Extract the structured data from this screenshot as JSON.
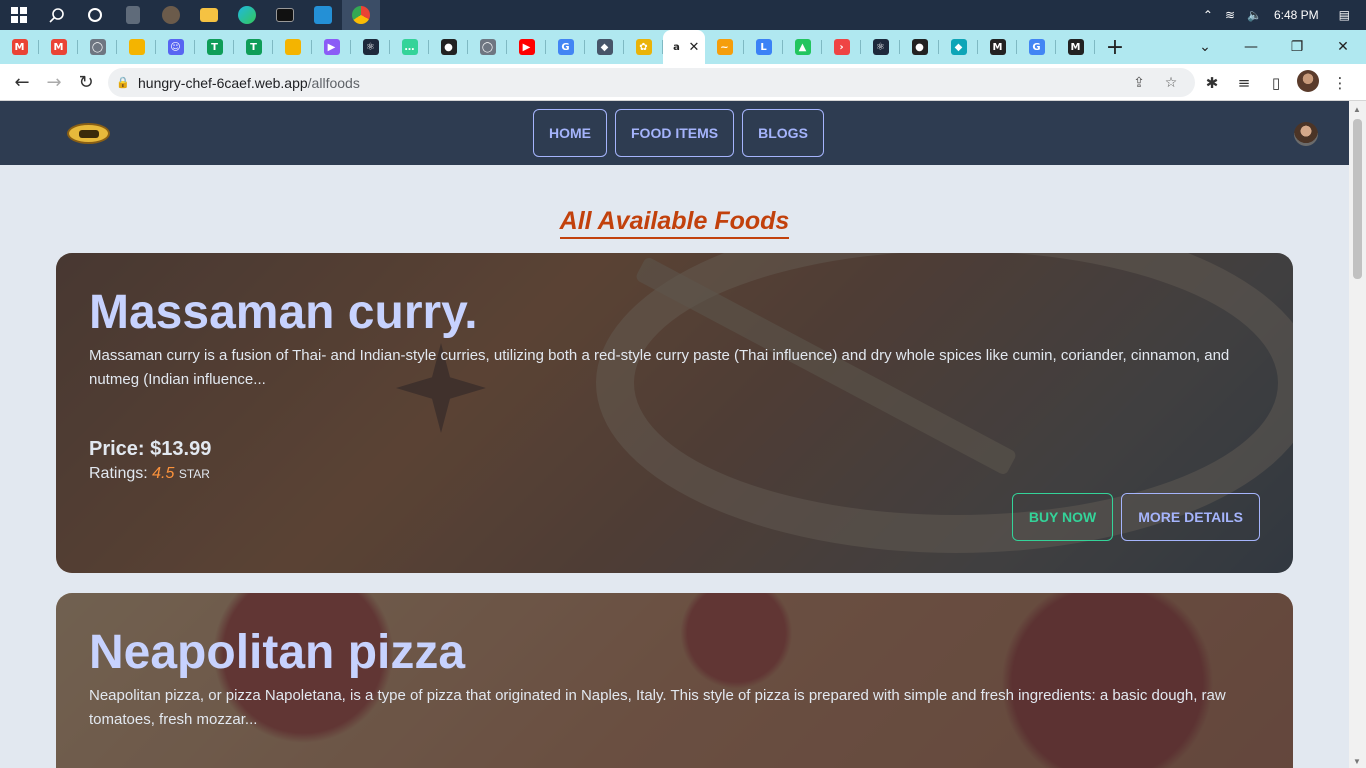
{
  "taskbar": {
    "time": "6:48 PM",
    "apps": [
      "start",
      "search",
      "task-view",
      "calculator",
      "media",
      "file-explorer",
      "edge",
      "terminal",
      "vscode",
      "chrome"
    ]
  },
  "browser": {
    "tabs": [
      {
        "icon": "gmail-icon",
        "color": "#ea4335",
        "glyph": "M"
      },
      {
        "icon": "gmail-icon",
        "color": "#ea4335",
        "glyph": "M"
      },
      {
        "icon": "github-icon",
        "color": "#6e7681",
        "glyph": "◯"
      },
      {
        "icon": "slides-icon",
        "color": "#f4b400",
        "glyph": ""
      },
      {
        "icon": "discord-icon",
        "color": "#5865f2",
        "glyph": "☺"
      },
      {
        "icon": "sheets-icon",
        "color": "#0f9d58",
        "glyph": "T"
      },
      {
        "icon": "sheets-icon",
        "color": "#0f9d58",
        "glyph": "T"
      },
      {
        "icon": "slides-icon",
        "color": "#f4b400",
        "glyph": ""
      },
      {
        "icon": "screencast-icon",
        "color": "#8b5cf6",
        "glyph": "▶"
      },
      {
        "icon": "react-icon",
        "color": "#1e293b",
        "glyph": "⚛"
      },
      {
        "icon": "chat-icon",
        "color": "#34d399",
        "glyph": "…"
      },
      {
        "icon": "globe-icon",
        "color": "#222222",
        "glyph": "●"
      },
      {
        "icon": "github-icon",
        "color": "#6e7681",
        "glyph": "◯"
      },
      {
        "icon": "youtube-icon",
        "color": "#ff0000",
        "glyph": "▶"
      },
      {
        "icon": "google-icon",
        "color": "#4285f4",
        "glyph": "G"
      },
      {
        "icon": "mortarboard-icon",
        "color": "#475569",
        "glyph": "◆"
      },
      {
        "icon": "flower-icon",
        "color": "#eab308",
        "glyph": "✿"
      },
      {
        "icon": "active-tab-icon",
        "color": "#ffffff",
        "glyph": "a",
        "active": true
      },
      {
        "icon": "brush-icon",
        "color": "#f59e0b",
        "glyph": "~"
      },
      {
        "icon": "lwc-icon",
        "color": "#3b82f6",
        "glyph": "L"
      },
      {
        "icon": "drive-icon",
        "color": "#22c55e",
        "glyph": "▲"
      },
      {
        "icon": "arrow-icon",
        "color": "#ef4444",
        "glyph": "›"
      },
      {
        "icon": "react-icon",
        "color": "#1e293b",
        "glyph": "⚛"
      },
      {
        "icon": "globe-icon",
        "color": "#222222",
        "glyph": "●"
      },
      {
        "icon": "diamond-icon",
        "color": "#0ea5b7",
        "glyph": "◆"
      },
      {
        "icon": "m-icon",
        "color": "#222222",
        "glyph": "M"
      },
      {
        "icon": "google-icon",
        "color": "#4285f4",
        "glyph": "G"
      },
      {
        "icon": "m-icon",
        "color": "#222222",
        "glyph": "M"
      }
    ],
    "url_host": "hungry-chef-6caef.web.app",
    "url_path": "/allfoods"
  },
  "site": {
    "nav": {
      "links": [
        "HOME",
        "FOOD ITEMS",
        "BLOGS"
      ]
    },
    "heading": "All Available Foods",
    "foods": [
      {
        "name": "Massaman curry.",
        "description": "Massaman curry is a fusion of Thai- and Indian-style curries, utilizing both a red-style curry paste (Thai influence) and dry whole spices like cumin, coriander, cinnamon, and nutmeg (Indian influence...",
        "price": "Price: $13.99",
        "ratings_label": "Ratings:",
        "rating": "4.5",
        "rating_unit": "STAR",
        "buy_label": "BUY NOW",
        "details_label": "MORE DETAILS"
      },
      {
        "name": "Neapolitan pizza",
        "description": "Neapolitan pizza, or pizza Napoletana, is a type of pizza that originated in Naples, Italy. This style of pizza is prepared with simple and fresh ingredients: a basic dough, raw tomatoes, fresh mozzar..."
      }
    ]
  }
}
